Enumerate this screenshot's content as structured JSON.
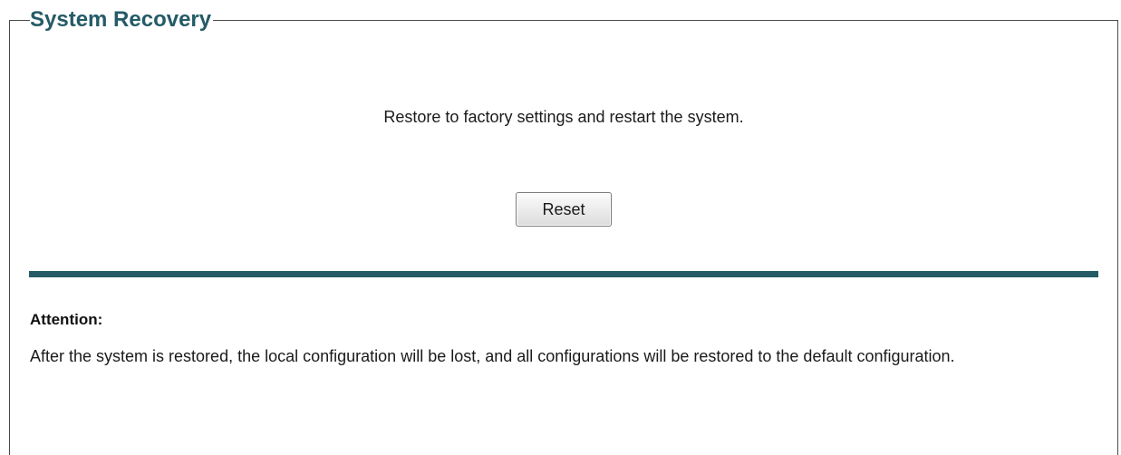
{
  "panel": {
    "title": "System Recovery"
  },
  "recovery": {
    "description": "Restore to factory settings and restart the system.",
    "reset_label": "Reset"
  },
  "attention": {
    "title": "Attention:",
    "text": "After the system is restored, the local configuration will be lost, and all configurations will be restored to the default configuration."
  },
  "colors": {
    "accent": "#245b66",
    "border": "#4a4a4a"
  }
}
